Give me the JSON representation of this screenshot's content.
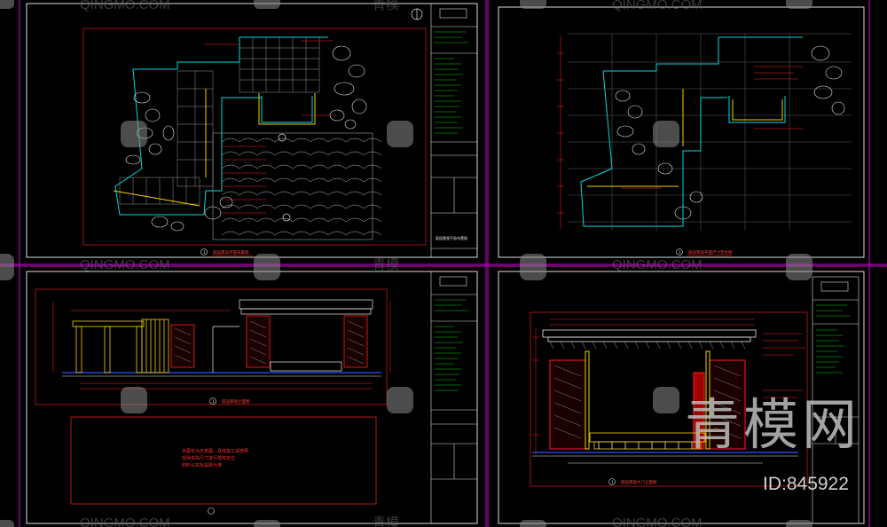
{
  "colors": {
    "background": "#000000",
    "sheet_border": "#b000b0",
    "frame": "#dcdcdc",
    "dimension": "#ff2020",
    "wall_cyan": "#00d8d8",
    "hardscape_yellow": "#f0d000",
    "stone_white": "#e8e8e8",
    "blue_line": "#3050ff",
    "green_text": "#00d000"
  },
  "watermarks": {
    "latin": "QINGMO.COM",
    "cn": "青模网",
    "cn_short": "青模",
    "big_cn": "青模网",
    "id_text": "ID:845922"
  },
  "sheets": [
    {
      "name": "plan-layout",
      "title_glyphs": "庭园景观平面布置图",
      "scale_mark": "1",
      "icon": "north-arrow-icon"
    },
    {
      "name": "plan-dimension",
      "title_glyphs": "庭园景观平面尺寸定位图",
      "scale_mark": "1",
      "icon": "grid-icon"
    },
    {
      "name": "elevation-main",
      "title_glyphs": "庭园景观立面图",
      "scale_mark": "1",
      "note_lines": [
        "本图仅为示意图，具体施工请按照",
        "现场实际尺寸进行放样定位",
        "材料以实际采购为准"
      ]
    },
    {
      "name": "elevation-gate",
      "title_glyphs": "庭园景观大门立面图",
      "scale_mark": "1"
    }
  ],
  "title_block": {
    "header": "",
    "project_label": "项目名称",
    "drawing_label": "图纸名称",
    "sheet_label": "图号",
    "ref_code": "LA-01"
  }
}
